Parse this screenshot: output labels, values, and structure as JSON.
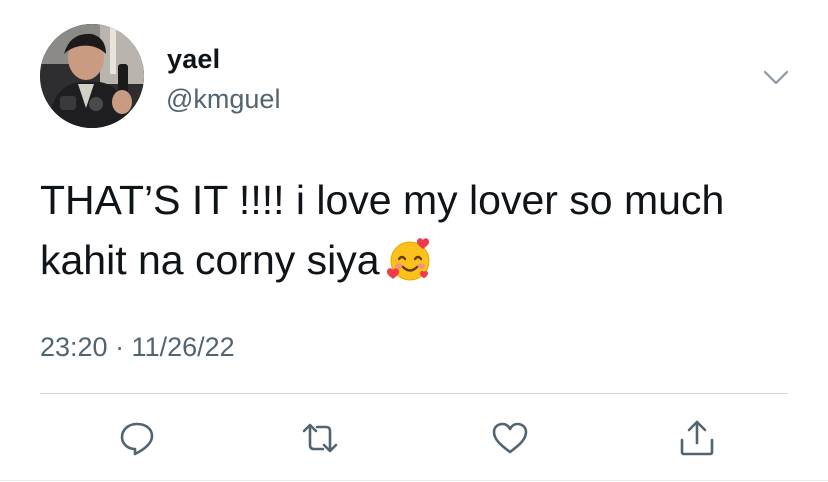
{
  "tweet": {
    "author": {
      "display_name": "yael",
      "handle": "@kmguel"
    },
    "text_lines": [
      "THAT’S IT !!!! i love my lover so much",
      "kahit na corny siya"
    ],
    "emoji": "smiling-face-with-hearts",
    "timestamp": "23:20 · 11/26/22"
  },
  "actions": [
    "reply-icon",
    "retweet-icon",
    "like-icon",
    "share-icon"
  ],
  "colors": {
    "text": "#0f1419",
    "secondary": "#536471",
    "divider": "#cfd9de"
  }
}
